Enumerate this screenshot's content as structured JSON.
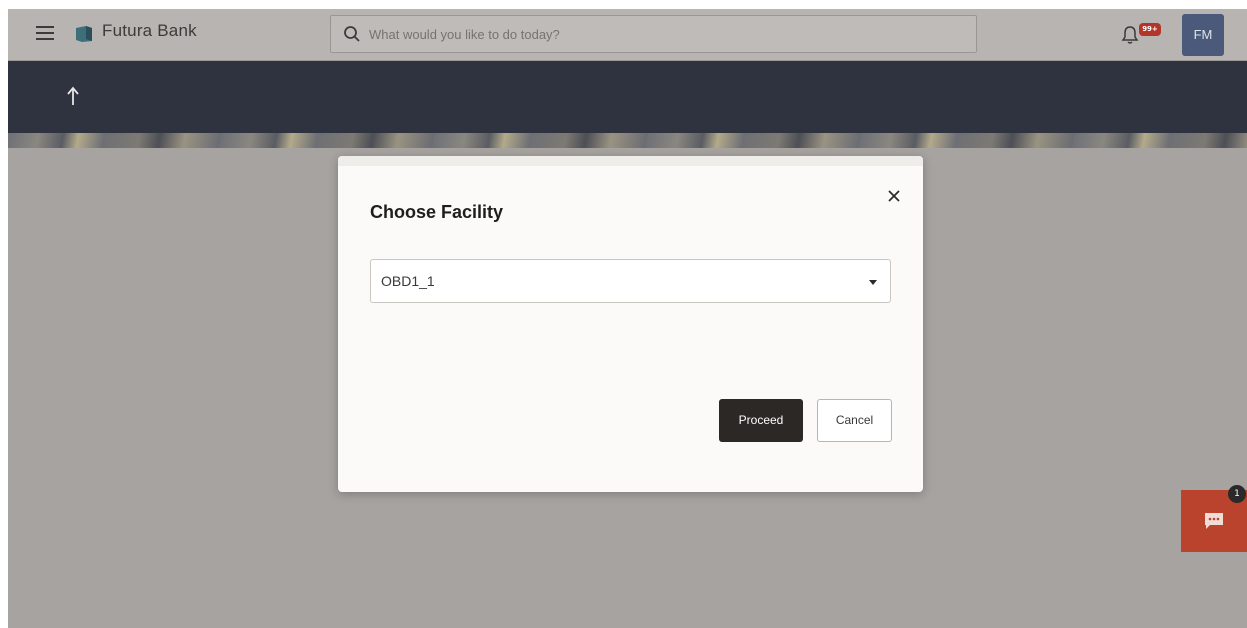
{
  "topbar": {
    "brand_name": "Futura Bank",
    "search_placeholder": "What would you like to do today?",
    "notification_badge": "99+",
    "avatar_initials": "FM"
  },
  "modal": {
    "title": "Choose Facility",
    "selected_facility": "OBD1_1",
    "proceed_label": "Proceed",
    "cancel_label": "Cancel"
  },
  "chat": {
    "badge_count": "1"
  },
  "colors": {
    "header_band": "#2f3340",
    "overlay": "#a7a3a0",
    "proceed_button": "#2c2825",
    "chat_widget": "#b9432c",
    "avatar": "#4b5a7a"
  },
  "icons": [
    "hamburger-menu-icon",
    "bank-logo-icon",
    "search-icon",
    "bell-icon",
    "back-arrow-icon",
    "close-icon",
    "caret-down-icon",
    "chat-icon"
  ]
}
